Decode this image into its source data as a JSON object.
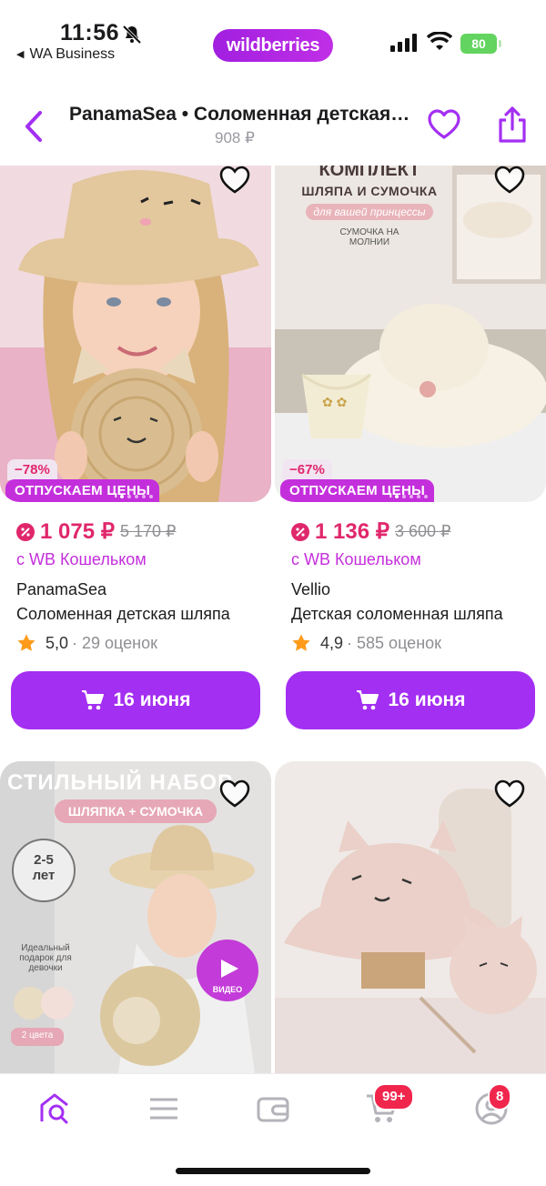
{
  "status_bar": {
    "time": "11:56",
    "back_app": "WA Business",
    "brand_pill": "wildberries",
    "battery": "80"
  },
  "header": {
    "title": "PanamaSea • Соломенная детская шляпа",
    "price": "908 ₽",
    "icons": [
      "chevron-left-icon",
      "heart-outline-icon",
      "share-icon"
    ]
  },
  "products": [
    {
      "discount": "−78%",
      "promo": "ОТПУСКАЕМ ЦЕНЫ",
      "price": "1 075 ₽",
      "old_price": "5 170 ₽",
      "wallet_note": "с WB Кошельком",
      "brand": "PanamaSea",
      "name": "Соломенная детская шляпа",
      "rating": "5,0",
      "reviews": "· 29 оценок",
      "delivery": "16 июня"
    },
    {
      "discount": "−67%",
      "promo": "ОТПУСКАЕМ ЦЕНЫ",
      "price": "1 136 ₽",
      "old_price": "3 600 ₽",
      "wallet_note": "с WB Кошельком",
      "brand": "Vellio",
      "name": "Детская соломенная шляпа",
      "rating": "4,9",
      "reviews": "· 585 оценок",
      "delivery": "16 июня",
      "photo_text": {
        "top": "КОМПЛЕКТ",
        "line1": "ШЛЯПА И СУМОЧКА",
        "line2": "для вашей принцессы",
        "tag": "СУМОЧКА НА МОЛНИИ"
      }
    },
    {
      "photo_text": {
        "title": "СТИЛЬНЫЙ НАБОР",
        "subtitle": "ШЛЯПКА + СУМОЧКА",
        "age": "2-5",
        "age_unit": "лет",
        "gift": "Идеальный подарок для девочки",
        "colors": "2 цвета",
        "video": "ВИДЕО"
      }
    },
    {}
  ],
  "tabbar": {
    "cart_badge": "99+",
    "profile_badge": "8",
    "icons": [
      "home-search-icon",
      "menu-icon",
      "wallet-icon",
      "cart-icon",
      "profile-icon"
    ]
  },
  "colors": {
    "accent": "#a32ff2",
    "price": "#e0276c",
    "promo": "#c42fdc",
    "badge": "#f0264d"
  }
}
